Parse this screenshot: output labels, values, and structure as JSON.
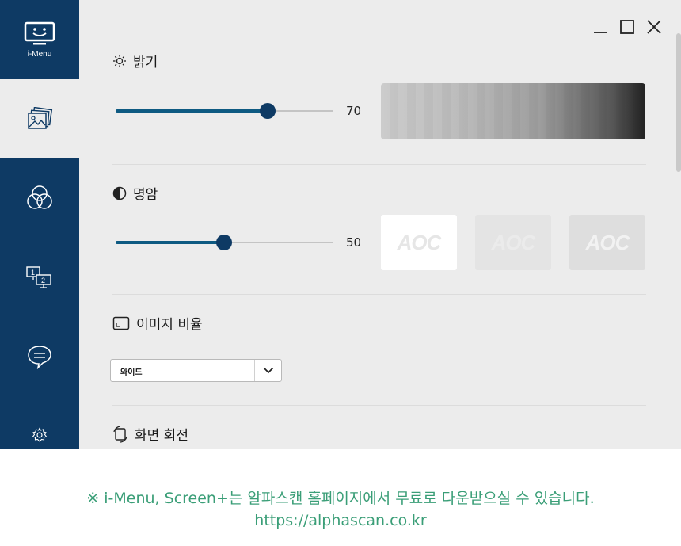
{
  "sidebar": {
    "logo_label": "i-Menu",
    "items": [
      {
        "icon": "picture-icon",
        "active": true
      },
      {
        "icon": "color-circles-icon",
        "active": false
      },
      {
        "icon": "multi-monitor-icon",
        "active": false
      },
      {
        "icon": "chat-icon",
        "active": false
      },
      {
        "icon": "settings-gear-icon",
        "active": false
      }
    ]
  },
  "window_controls": [
    "minimize",
    "maximize",
    "close"
  ],
  "brightness": {
    "title": "밝기",
    "value": "70",
    "level_percent": 70
  },
  "contrast": {
    "title": "명암",
    "value": "50",
    "level_percent": 50,
    "previews": [
      {
        "label": "AOC",
        "bg": "#ffffff",
        "fg": "#e6e6e6"
      },
      {
        "label": "AOC",
        "bg": "#e4e4e4",
        "fg": "#ebebeb"
      },
      {
        "label": "AOC",
        "bg": "#dedede",
        "fg": "#f2f2f2"
      }
    ]
  },
  "aspect_ratio": {
    "title": "이미지 비율",
    "selected": "와이드"
  },
  "rotation": {
    "title": "화면 회전"
  },
  "footer": {
    "line1": "※ i-Menu, Screen+는 알파스캔 홈페이지에서 무료로 다운받으실 수 있습니다.",
    "line2": "https://alphascan.co.kr"
  },
  "colors": {
    "sidebar": "#0e3a64",
    "accent": "#0e5a82",
    "background": "#ececec",
    "footer_text": "#3a9e77"
  }
}
